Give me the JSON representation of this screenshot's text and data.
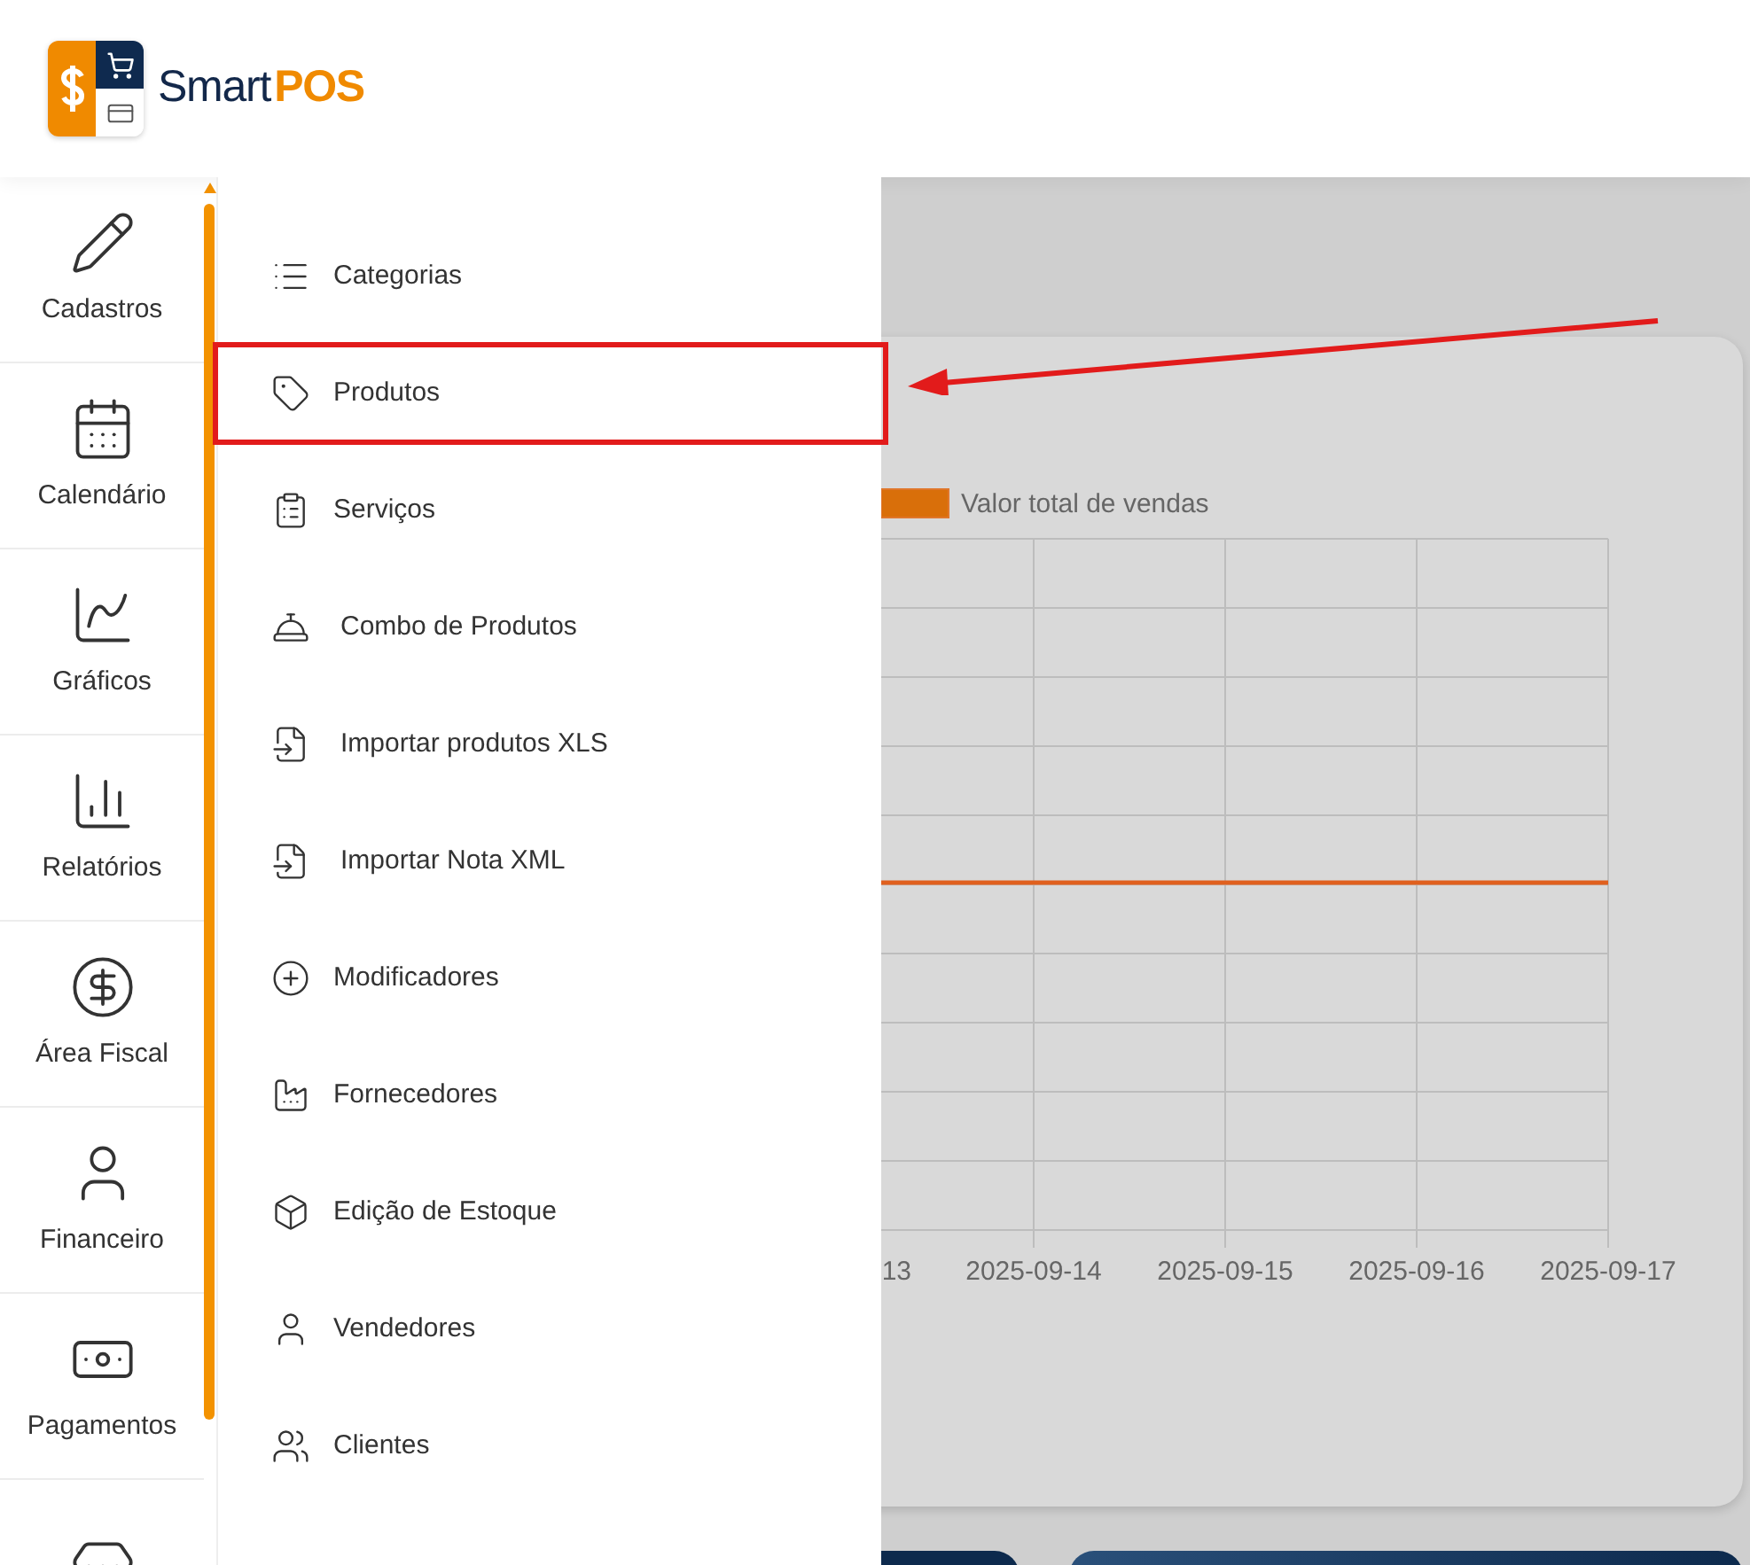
{
  "header": {
    "logo": {
      "word": "Smart",
      "accent": "POS"
    }
  },
  "rail": {
    "items": [
      {
        "kind": "labeled",
        "label": "Cadastros"
      },
      {
        "kind": "labeled",
        "label": "Calendário"
      },
      {
        "kind": "labeled",
        "label": "Gráficos"
      },
      {
        "kind": "labeled",
        "label": "Relatórios"
      },
      {
        "kind": "labeled",
        "label": "Área Fiscal"
      },
      {
        "kind": "labeled",
        "label": "Financeiro"
      },
      {
        "kind": "labeled",
        "label": "Pagamentos"
      },
      {
        "kind": "icon_only"
      }
    ]
  },
  "submenu": {
    "items": [
      {
        "label": "Categorias",
        "highlighted": false
      },
      {
        "label": "Produtos",
        "highlighted": true
      },
      {
        "label": "Serviços",
        "highlighted": false
      },
      {
        "label": "Combo de Produtos",
        "highlighted": false
      },
      {
        "label": "Importar produtos XLS",
        "highlighted": false
      },
      {
        "label": "Importar Nota XML",
        "highlighted": false
      },
      {
        "label": "Modificadores",
        "highlighted": false
      },
      {
        "label": "Fornecedores",
        "highlighted": false
      },
      {
        "label": "Edição de Estoque",
        "highlighted": false
      },
      {
        "label": "Vendedores",
        "highlighted": false
      },
      {
        "label": "Clientes",
        "highlighted": false
      }
    ]
  },
  "chart": {
    "legend": "Valor total de vendas",
    "x_labels": [
      "13",
      "2025-09-14",
      "2025-09-15",
      "2025-09-16",
      "2025-09-17"
    ]
  }
}
